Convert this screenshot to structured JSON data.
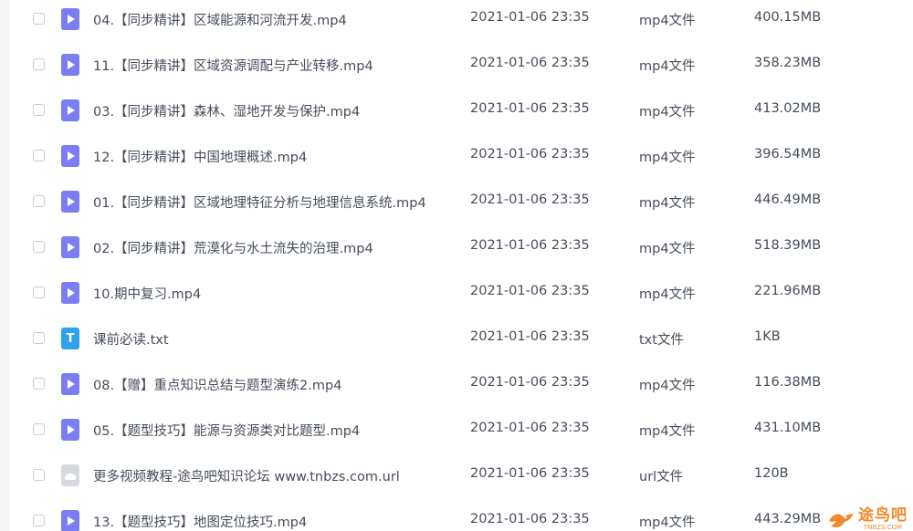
{
  "colors": {
    "video_icon": "#7a7ef2",
    "text_icon": "#2ea2ef",
    "link_icon": "#d6dae0",
    "row_text": "#454d5a",
    "watermark": "#f08a2c"
  },
  "files": [
    {
      "name": "04.【同步精讲】区域能源和河流开发.mp4",
      "date": "2021-01-06 23:35",
      "type": "mp4文件",
      "size": "400.15MB",
      "icon": "video-file-icon"
    },
    {
      "name": "11.【同步精讲】区域资源调配与产业转移.mp4",
      "date": "2021-01-06 23:35",
      "type": "mp4文件",
      "size": "358.23MB",
      "icon": "video-file-icon"
    },
    {
      "name": "03.【同步精讲】森林、湿地开发与保护.mp4",
      "date": "2021-01-06 23:35",
      "type": "mp4文件",
      "size": "413.02MB",
      "icon": "video-file-icon"
    },
    {
      "name": "12.【同步精讲】中国地理概述.mp4",
      "date": "2021-01-06 23:35",
      "type": "mp4文件",
      "size": "396.54MB",
      "icon": "video-file-icon"
    },
    {
      "name": "01.【同步精讲】区域地理特征分析与地理信息系统.mp4",
      "date": "2021-01-06 23:35",
      "type": "mp4文件",
      "size": "446.49MB",
      "icon": "video-file-icon"
    },
    {
      "name": "02.【同步精讲】荒漠化与水土流失的治理.mp4",
      "date": "2021-01-06 23:35",
      "type": "mp4文件",
      "size": "518.39MB",
      "icon": "video-file-icon"
    },
    {
      "name": "10.期中复习.mp4",
      "date": "2021-01-06 23:35",
      "type": "mp4文件",
      "size": "221.96MB",
      "icon": "video-file-icon"
    },
    {
      "name": "课前必读.txt",
      "date": "2021-01-06 23:35",
      "type": "txt文件",
      "size": "1KB",
      "icon": "text-file-icon",
      "glyph": "T"
    },
    {
      "name": "08.【赠】重点知识总结与题型演练2.mp4",
      "date": "2021-01-06 23:35",
      "type": "mp4文件",
      "size": "116.38MB",
      "icon": "video-file-icon"
    },
    {
      "name": "05.【题型技巧】能源与资源类对比题型.mp4",
      "date": "2021-01-06 23:35",
      "type": "mp4文件",
      "size": "431.10MB",
      "icon": "video-file-icon"
    },
    {
      "name": "更多视频教程-途鸟吧知识论坛 www.tnbzs.com.url",
      "date": "2021-01-06 23:35",
      "type": "url文件",
      "size": "120B",
      "icon": "link-file-icon"
    },
    {
      "name": "13.【题型技巧】地图定位技巧.mp4",
      "date": "2021-01-06 23:35",
      "type": "mp4文件",
      "size": "443.29MB",
      "icon": "video-file-icon"
    }
  ],
  "watermark": {
    "title": "途鸟吧",
    "domain": "TNBZS.COM",
    "icon": "bird-logo-icon"
  }
}
